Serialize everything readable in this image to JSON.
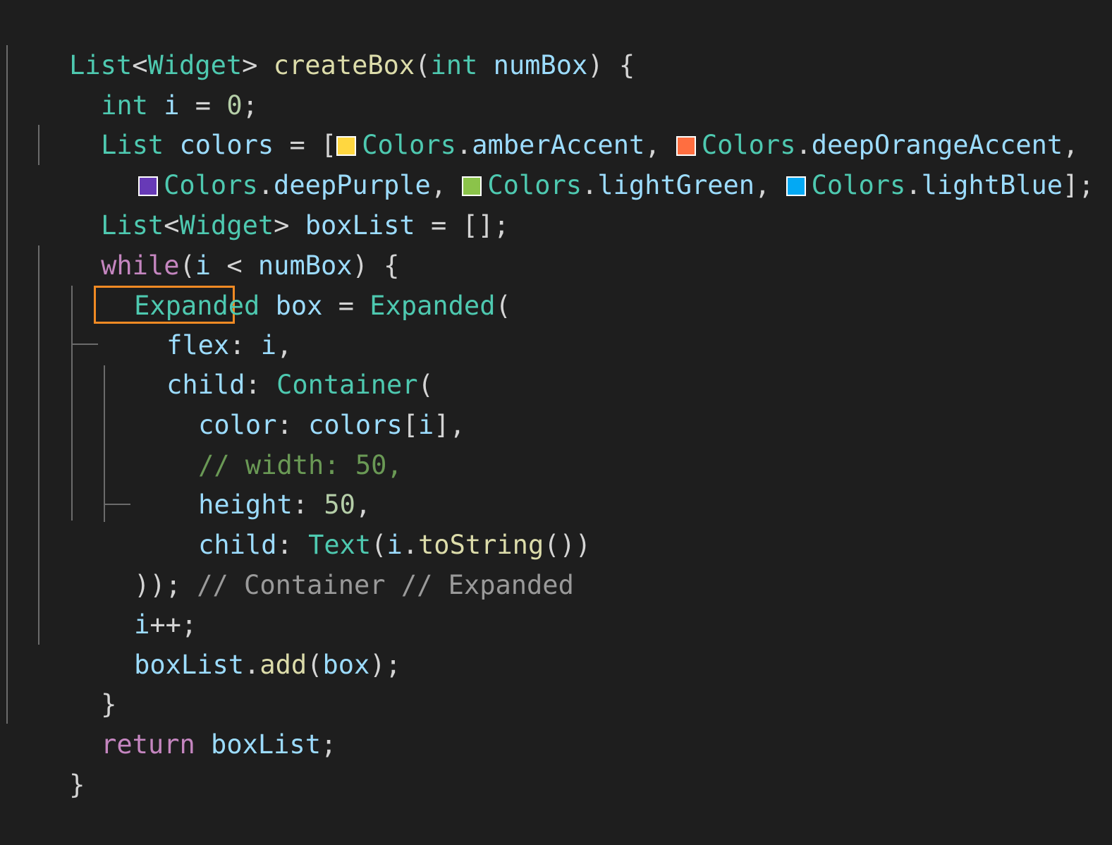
{
  "code": {
    "l1": {
      "a": "List",
      "b": "<",
      "c": "Widget",
      "d": ">",
      "e": "createBox",
      "f": "(",
      "g": "int",
      "h": "numBox",
      "i": ")",
      "j": "{"
    },
    "l2": {
      "a": "int",
      "b": "i",
      "c": "=",
      "d": "0",
      "e": ";"
    },
    "l3": {
      "a": "List",
      "b": "colors",
      "c": "=",
      "d": "[",
      "e": "Colors",
      "f": ".",
      "g": "amberAccent",
      "h": ",",
      "i": "Colors",
      "j": ".",
      "k": "deepOrangeAccent",
      "l": ","
    },
    "l4": {
      "a": "Colors",
      "b": ".",
      "c": "deepPurple",
      "d": ",",
      "e": "Colors",
      "f": ".",
      "g": "lightGreen",
      "h": ",",
      "i": "Colors",
      "j": ".",
      "k": "lightBlue",
      "l": "];"
    },
    "l5": {
      "a": "List",
      "b": "<",
      "c": "Widget",
      "d": ">",
      "e": "boxList",
      "f": "=",
      "g": "[];"
    },
    "l6": {
      "a": "while",
      "b": "(",
      "c": "i",
      "d": "<",
      "e": "numBox",
      "f": ")",
      "g": "{"
    },
    "l7": {
      "a": "Expanded",
      "b": "box",
      "c": "=",
      "d": "Expanded",
      "e": "("
    },
    "l8": {
      "a": "flex",
      "b": ":",
      "c": "i",
      "d": ","
    },
    "l9": {
      "a": "child",
      "b": ":",
      "c": "Container",
      "d": "("
    },
    "l10": {
      "a": "color",
      "b": ":",
      "c": "colors",
      "d": "[",
      "e": "i",
      "f": "],"
    },
    "l11": {
      "a": "// width: 50,"
    },
    "l12": {
      "a": "height",
      "b": ":",
      "c": "50",
      "d": ","
    },
    "l13": {
      "a": "child",
      "b": ":",
      "c": "Text",
      "d": "(",
      "e": "i",
      "f": ".",
      "g": "toString",
      "h": "())"
    },
    "l14": {
      "a": "));",
      "b": "// Container",
      "c": "// Expanded"
    },
    "l15": {
      "a": "i",
      "b": "++;"
    },
    "l16": {
      "a": "boxList",
      "b": ".",
      "c": "add",
      "d": "(",
      "e": "box",
      "f": ");"
    },
    "l17": {
      "a": "}"
    },
    "l18": {
      "a": "return",
      "b": "boxList",
      "c": ";"
    },
    "l19": {
      "a": "}"
    }
  },
  "swatches": {
    "amberAccent": "#ffd740",
    "deepOrangeAccent": "#ff6e40",
    "deepPurple": "#673ab7",
    "lightGreen": "#8bc34a",
    "lightBlue": "#03a9f4"
  },
  "highlight_color": "#f08a24",
  "background": "#1e1e1e"
}
